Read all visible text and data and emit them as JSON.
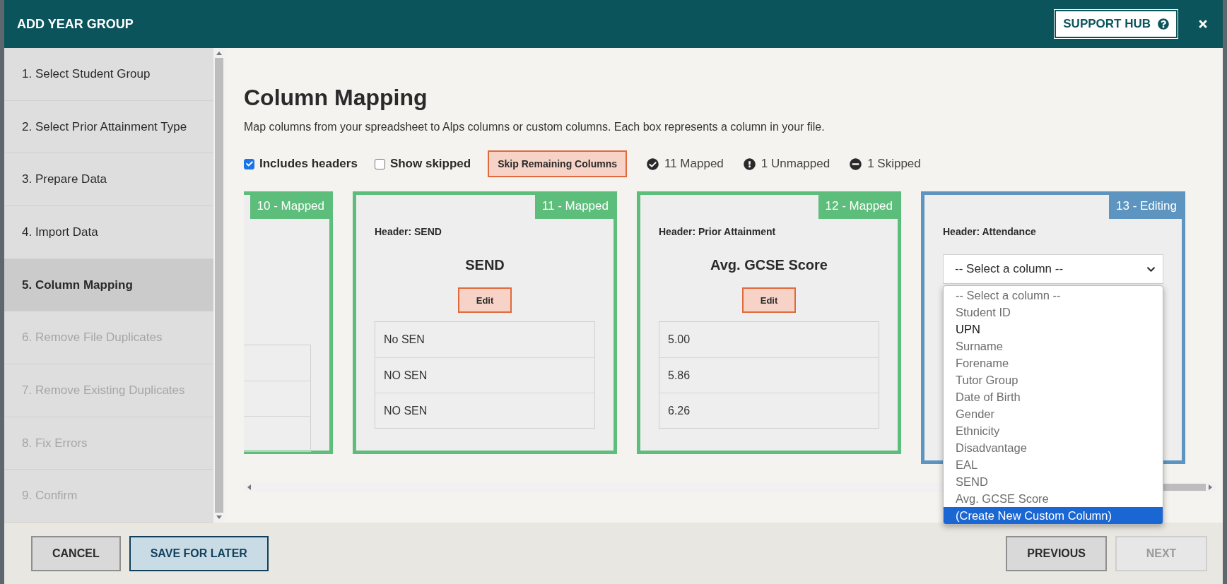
{
  "dialog": {
    "title": "ADD YEAR GROUP",
    "support_button": "SUPPORT HUB"
  },
  "sidebar": {
    "items": [
      {
        "label": "1. Select Student Group",
        "selected": false,
        "disabled": false
      },
      {
        "label": "2. Select Prior Attainment Type",
        "selected": false,
        "disabled": false
      },
      {
        "label": "3. Prepare Data",
        "selected": false,
        "disabled": false
      },
      {
        "label": "4. Import Data",
        "selected": false,
        "disabled": false
      },
      {
        "label": "5. Column Mapping",
        "selected": true,
        "disabled": false
      },
      {
        "label": "6. Remove File Duplicates",
        "selected": false,
        "disabled": true
      },
      {
        "label": "7. Remove Existing Duplicates",
        "selected": false,
        "disabled": true
      },
      {
        "label": "8. Fix Errors",
        "selected": false,
        "disabled": true
      },
      {
        "label": "9. Confirm",
        "selected": false,
        "disabled": true
      }
    ]
  },
  "page": {
    "title": "Column Mapping",
    "description": "Map columns from your spreadsheet to Alps columns or custom columns. Each box represents a column in your file."
  },
  "toolbar": {
    "checkboxes": [
      {
        "label": "Includes headers",
        "checked": true
      },
      {
        "label": "Show skipped",
        "checked": false
      }
    ],
    "skip_button": "Skip Remaining Columns",
    "counts": [
      {
        "kind": "mapped",
        "label": "11 Mapped"
      },
      {
        "kind": "unmapped",
        "label": "1 Unmapped"
      },
      {
        "kind": "skipped",
        "label": "1 Skipped"
      }
    ]
  },
  "cards": [
    {
      "color": "#5dbd7b",
      "badge": "10 - Mapped"
    },
    {
      "color": "#5dbd7b",
      "badge": "11 - Mapped",
      "header": "Header: SEND",
      "mapped_to": "SEND",
      "edit_button": "Edit",
      "cells": [
        "No SEN",
        "NO SEN",
        "NO SEN"
      ]
    },
    {
      "color": "#5dbd7b",
      "badge": "12 - Mapped",
      "header": "Header: Prior Attainment",
      "mapped_to": "Avg. GCSE Score",
      "edit_button": "Edit",
      "cells": [
        "5.00",
        "5.86",
        "6.26"
      ]
    },
    {
      "color": "#5d95c0",
      "badge": "13 - Editing",
      "header": "Header: Attendance",
      "select": {
        "value": "-- Select a column --",
        "expanded": true,
        "options": [
          {
            "label": "-- Select a column --",
            "disabled": true,
            "highlighted": false
          },
          {
            "label": "Student ID",
            "disabled": true,
            "highlighted": false
          },
          {
            "label": "UPN",
            "disabled": false,
            "highlighted": false
          },
          {
            "label": "Surname",
            "disabled": true,
            "highlighted": false
          },
          {
            "label": "Forename",
            "disabled": true,
            "highlighted": false
          },
          {
            "label": "Tutor Group",
            "disabled": true,
            "highlighted": false
          },
          {
            "label": "Date of Birth",
            "disabled": true,
            "highlighted": false
          },
          {
            "label": "Gender",
            "disabled": true,
            "highlighted": false
          },
          {
            "label": "Ethnicity",
            "disabled": true,
            "highlighted": false
          },
          {
            "label": "Disadvantage",
            "disabled": true,
            "highlighted": false
          },
          {
            "label": "EAL",
            "disabled": true,
            "highlighted": false
          },
          {
            "label": "SEND",
            "disabled": true,
            "highlighted": false
          },
          {
            "label": "Avg. GCSE Score",
            "disabled": true,
            "highlighted": false
          },
          {
            "label": "(Create New Custom Column)",
            "disabled": false,
            "highlighted": true
          }
        ]
      }
    }
  ],
  "footer": {
    "buttons": [
      {
        "kind": "cancel",
        "label": "CANCEL",
        "disabled": false
      },
      {
        "kind": "save",
        "label": "SAVE FOR LATER",
        "disabled": false
      },
      {
        "kind": "spacer"
      },
      {
        "kind": "nav",
        "label": "PREVIOUS",
        "disabled": false
      },
      {
        "kind": "nav",
        "label": "NEXT",
        "disabled": true
      }
    ]
  }
}
